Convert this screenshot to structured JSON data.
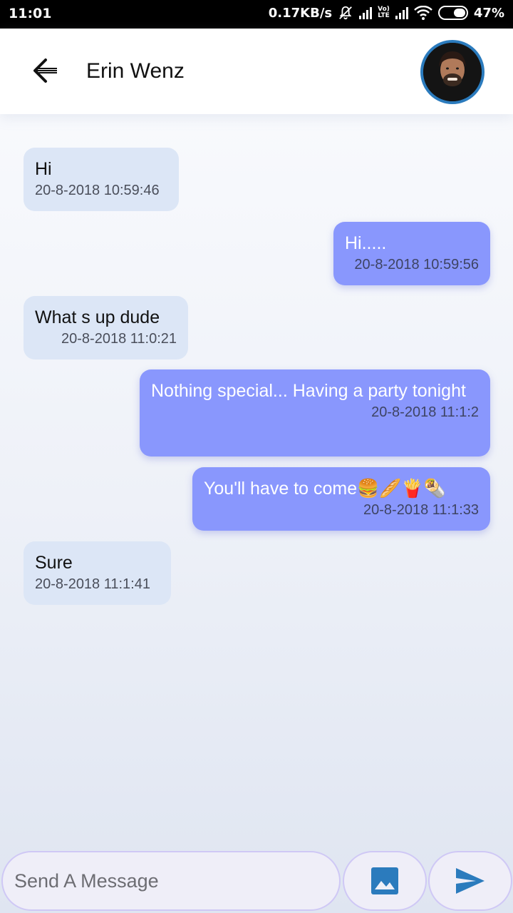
{
  "status_bar": {
    "time": "11:01",
    "network_speed": "0.17KB/s",
    "lte_top": "Vo)",
    "lte_bottom": "LTE",
    "battery": "47%"
  },
  "header": {
    "contact_name": "Erin Wenz"
  },
  "messages": [
    {
      "direction": "in",
      "text": "Hi",
      "time": "20-8-2018 10:59:46"
    },
    {
      "direction": "out",
      "text": "Hi.....",
      "time": "20-8-2018 10:59:56"
    },
    {
      "direction": "in",
      "text": "What s up dude",
      "time": "20-8-2018 11:0:21"
    },
    {
      "direction": "out",
      "text": "Nothing special... Having a party tonight",
      "time": "20-8-2018 11:1:2"
    },
    {
      "direction": "out",
      "text": "You'll have to come🍔🥖🍟🌯",
      "time": "20-8-2018 11:1:33"
    },
    {
      "direction": "in",
      "text": "Sure",
      "time": "20-8-2018 11:1:41"
    }
  ],
  "composer": {
    "placeholder": "Send A Message",
    "value": ""
  },
  "colors": {
    "incoming_bubble": "#dce6f6",
    "outgoing_bubble": "#8997fd",
    "accent": "#2b7bbd"
  },
  "icons": {
    "back": "arrow-left-icon",
    "image": "image-icon",
    "send": "send-icon"
  }
}
